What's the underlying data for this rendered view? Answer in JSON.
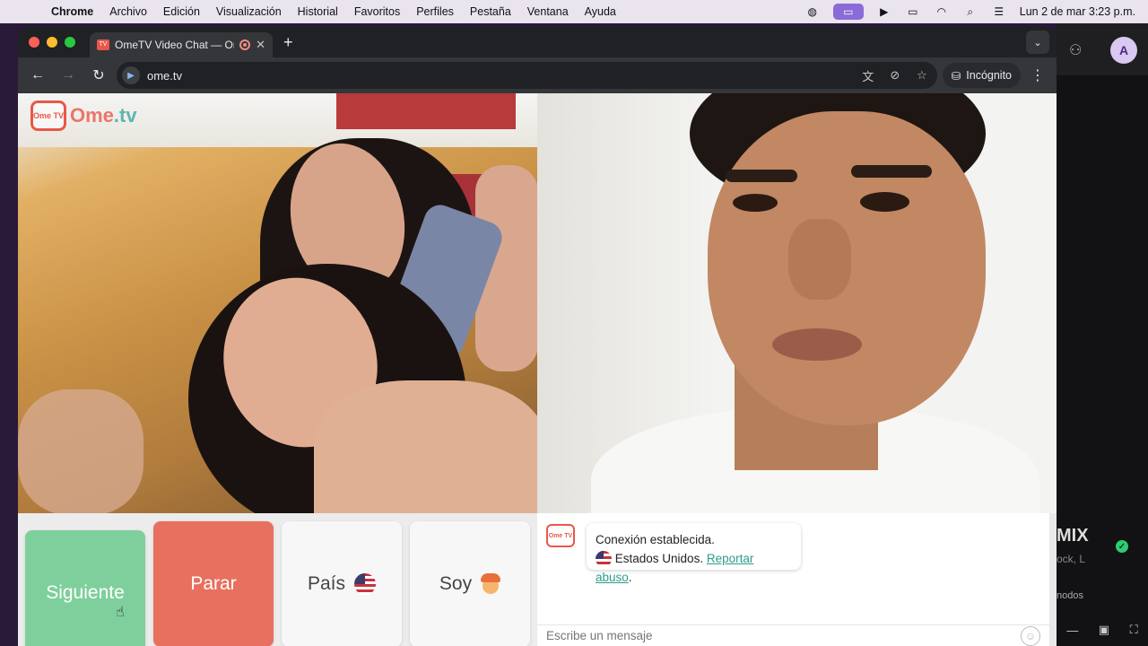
{
  "menubar": {
    "apple_icon": "apple-icon",
    "app_name": "Chrome",
    "items": [
      "Archivo",
      "Edición",
      "Visualización",
      "Historial",
      "Favoritos",
      "Perfiles",
      "Pestaña",
      "Ventana",
      "Ayuda"
    ],
    "clock": "Lun 2 de mar  3:23 p.m."
  },
  "browser": {
    "tab_title": "OmeTV Video Chat — Ome",
    "new_tab_glyph": "+",
    "url": "ome.tv",
    "incognito_label": "Incógnito"
  },
  "page": {
    "logo_prefix": "Ome",
    "logo_suffix": ".tv",
    "logo_tv_text": "Ome TV",
    "buttons": {
      "next": "Siguiente",
      "stop": "Parar",
      "country": "País",
      "gender": "Soy"
    },
    "chat": {
      "message_line1": "Conexión establecida.",
      "country": "Estados Unidos.",
      "report_link": "Reportar abuso",
      "trailing": ".",
      "input_placeholder": "Escribe un mensaje"
    }
  },
  "desktop": {
    "profile_initial": "A",
    "mix_text": "MIX",
    "sub_text": "ock, L",
    "small_text": "nodos"
  },
  "colors": {
    "accent_next": "#7fcf9c",
    "accent_stop": "#e8705e",
    "brand_red": "#e8584a",
    "link_teal": "#2e9c8e"
  }
}
